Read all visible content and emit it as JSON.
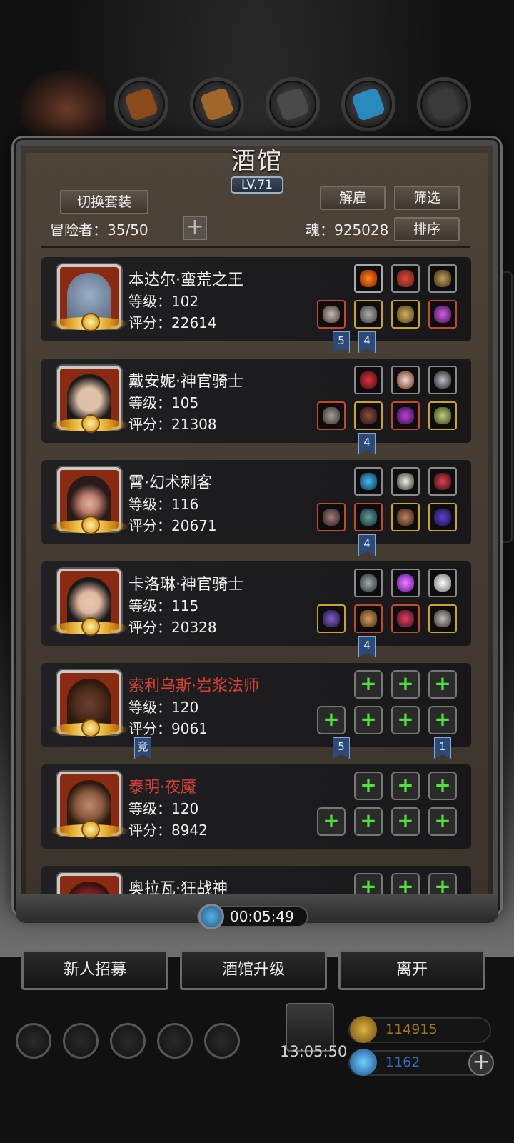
{
  "title": "酒馆",
  "level_badge": "LV.71",
  "buttons": {
    "switch_outfit": "切换套装",
    "dismiss": "解雇",
    "filter": "筛选",
    "sort": "排序",
    "add": "+"
  },
  "stats": {
    "adventurers_label": "冒险者：35/50",
    "soul_label": "魂：925028"
  },
  "heroes": [
    {
      "name": "本达尔·蛮荒之王",
      "level": "等级：102",
      "score": "评分：22614",
      "name_color": "white"
    },
    {
      "name": "戴安妮·神官骑士",
      "level": "等级：105",
      "score": "评分：21308",
      "name_color": "white"
    },
    {
      "name": "霄·幻术刺客",
      "level": "等级：116",
      "score": "评分：20671",
      "name_color": "white"
    },
    {
      "name": "卡洛琳·神官骑士",
      "level": "等级：115",
      "score": "评分：20328",
      "name_color": "white"
    },
    {
      "name": "索利乌斯·岩浆法师",
      "level": "等级：120",
      "score": "评分：9061",
      "name_color": "red"
    },
    {
      "name": "泰明·夜魇",
      "level": "等级：120",
      "score": "评分：8942",
      "name_color": "red"
    },
    {
      "name": "奥拉瓦·狂战神",
      "name_color": "white"
    }
  ],
  "tags": {
    "t1": "5",
    "t2": "4",
    "t3": "4",
    "t4": "4",
    "t5": "4",
    "t6": "竞",
    "t7": "5",
    "t8": "1"
  },
  "timer": "00:05:49",
  "bottom_buttons": {
    "recruit": "新人招募",
    "upgrade": "酒馆升级",
    "leave": "离开"
  },
  "gift_timer": "13:05:50",
  "resources": {
    "gold": "114915",
    "gems": "1162"
  },
  "colors": {
    "name_red": "#d8413a",
    "tag_blue": "#2c4a78",
    "plus_green": "#4fe23a"
  }
}
